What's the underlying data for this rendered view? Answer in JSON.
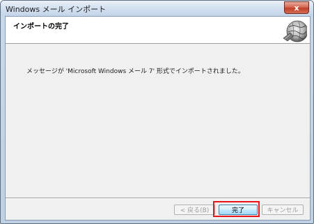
{
  "window": {
    "title": "Windows メール インポート",
    "close_label": "x"
  },
  "header": {
    "title": "インポートの完了"
  },
  "main": {
    "message": "メッセージが 'Microsoft Windows メール 7' 形式でインポートされました。"
  },
  "buttons": {
    "back_label": "< 戻る(B)",
    "finish_label": "完了",
    "cancel_label": "キャンセル"
  },
  "colors": {
    "highlight": "#e8151b",
    "title_gradient_top": "#e9f0f8",
    "client_background": "#f0f0f0"
  },
  "icons": {
    "header_logo": "globe-logo-icon",
    "close": "close-icon"
  }
}
